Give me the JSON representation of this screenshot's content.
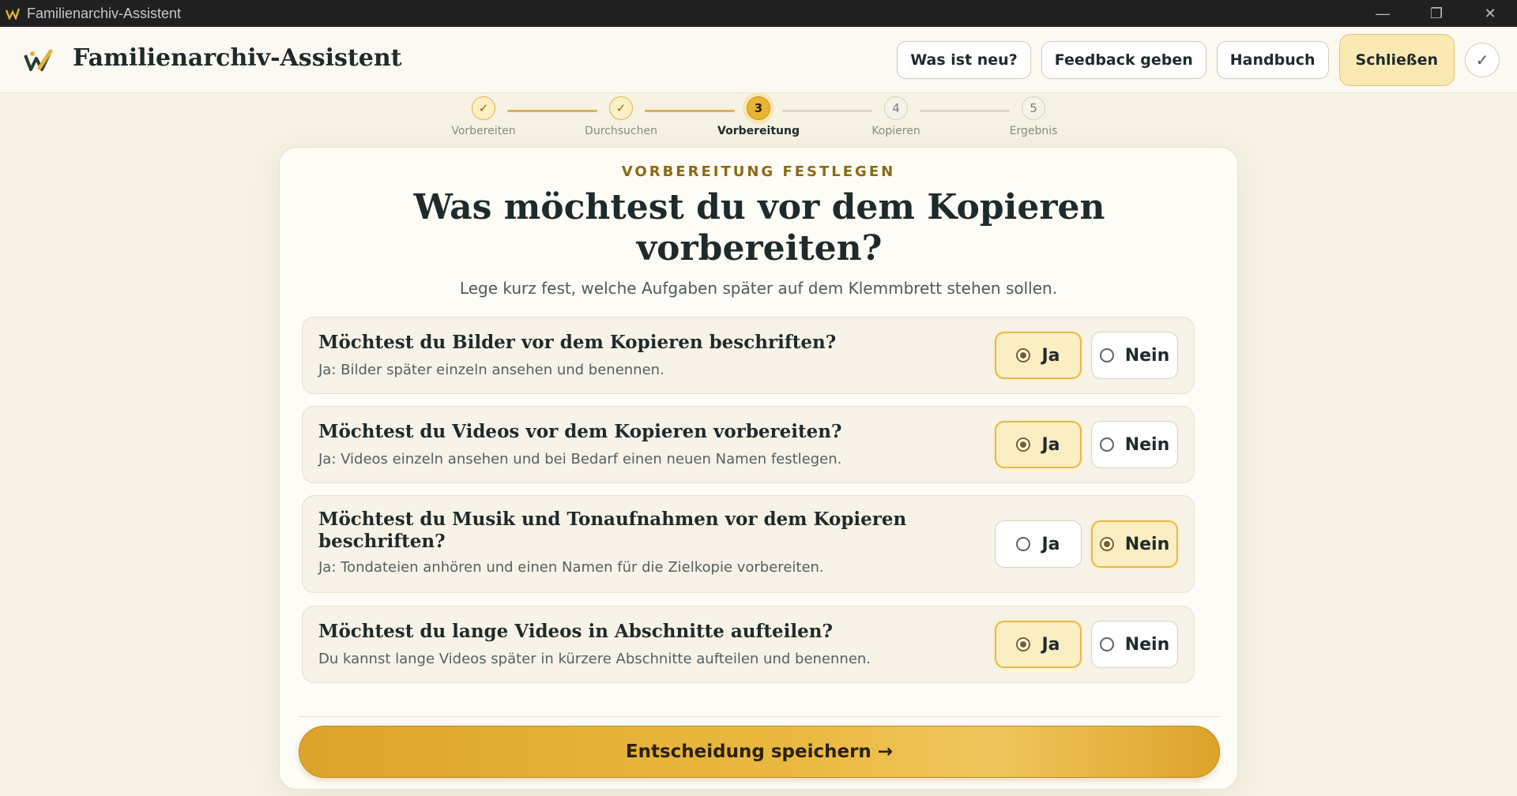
{
  "window": {
    "title": "Familienarchiv-Assistent",
    "minimize": "—",
    "restore": "❐",
    "close": "✕"
  },
  "header": {
    "brand": "Familienarchiv-Assistent",
    "buttons": {
      "whats_new": "Was ist neu?",
      "feedback": "Feedback geben",
      "manual": "Handbuch",
      "close": "Schließen",
      "check": "✓"
    }
  },
  "stepper": {
    "steps": [
      {
        "label": "Vorbereiten",
        "marker": "✓",
        "state": "done"
      },
      {
        "label": "Durchsuchen",
        "marker": "✓",
        "state": "done"
      },
      {
        "label": "Vorbereitung",
        "marker": "3",
        "state": "active"
      },
      {
        "label": "Kopieren",
        "marker": "4",
        "state": "todo"
      },
      {
        "label": "Ergebnis",
        "marker": "5",
        "state": "todo"
      }
    ]
  },
  "card": {
    "eyebrow": "VORBEREITUNG FESTLEGEN",
    "title": "Was möchtest du vor dem Kopieren vorbereiten?",
    "subtitle": "Lege kurz fest, welche Aufgaben später auf dem Klemmbrett stehen sollen.",
    "questions": [
      {
        "question": "Möchtest du Bilder vor dem Kopieren beschriften?",
        "description": "Ja: Bilder später einzeln ansehen und benennen.",
        "yes": "Ja",
        "no": "Nein",
        "selected": "Ja"
      },
      {
        "question": "Möchtest du Videos vor dem Kopieren vorbereiten?",
        "description": "Ja: Videos einzeln ansehen und bei Bedarf einen neuen Namen festlegen.",
        "yes": "Ja",
        "no": "Nein",
        "selected": "Ja"
      },
      {
        "question": "Möchtest du Musik und Tonaufnahmen vor dem Kopieren beschriften?",
        "description": "Ja: Tondateien anhören und einen Namen für die Zielkopie vorbereiten.",
        "yes": "Ja",
        "no": "Nein",
        "selected": "Nein"
      },
      {
        "question": "Möchtest du lange Videos in Abschnitte aufteilen?",
        "description": "Du kannst lange Videos später in kürzere Abschnitte aufteilen und benennen.",
        "yes": "Ja",
        "no": "Nein",
        "selected": "Ja"
      }
    ],
    "save_button": "Entscheidung speichern  →"
  },
  "colors": {
    "accent": "#e9b431",
    "accent_dark": "#8a6a12",
    "background": "#f6f2e4",
    "text": "#1f2a2a"
  }
}
